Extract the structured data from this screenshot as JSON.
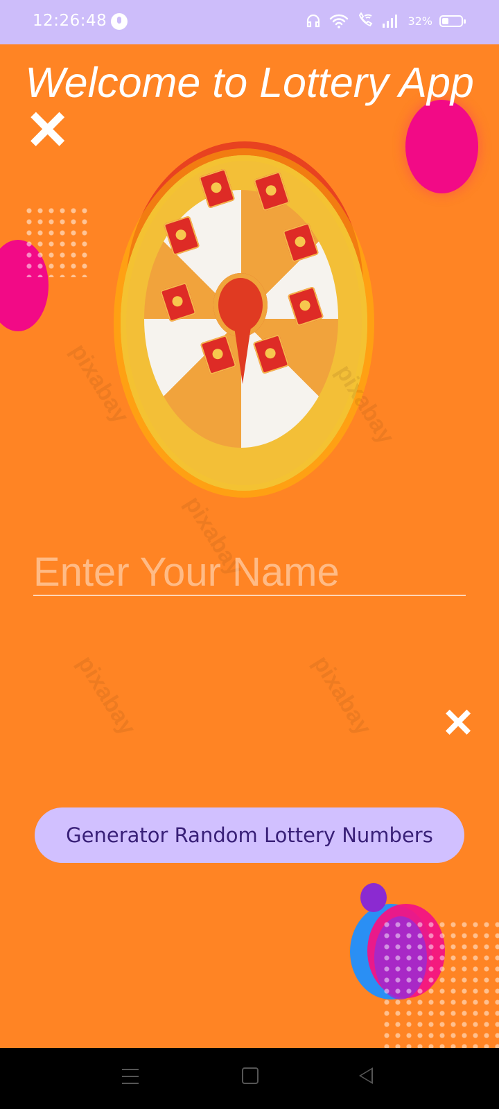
{
  "status_bar": {
    "time": "12:26:48",
    "battery_percent": "32%",
    "icons": [
      "app-notification-icon",
      "headset-icon",
      "wifi-icon",
      "wifi-calling-icon",
      "signal-icon",
      "battery-icon"
    ]
  },
  "app": {
    "title": "Welcome to Lottery App",
    "name_input": {
      "placeholder": "Enter Your Name",
      "value": ""
    },
    "generate_button_label": "Generator Random Lottery Numbers"
  },
  "navigation": {
    "icons": [
      "menu-icon",
      "home-icon",
      "back-icon"
    ]
  },
  "colors": {
    "status_bar": "#cdbdfa",
    "background": "#ff8424",
    "button": "#d1c0ff",
    "button_text": "#392078",
    "navigation_bar": "#000000"
  }
}
